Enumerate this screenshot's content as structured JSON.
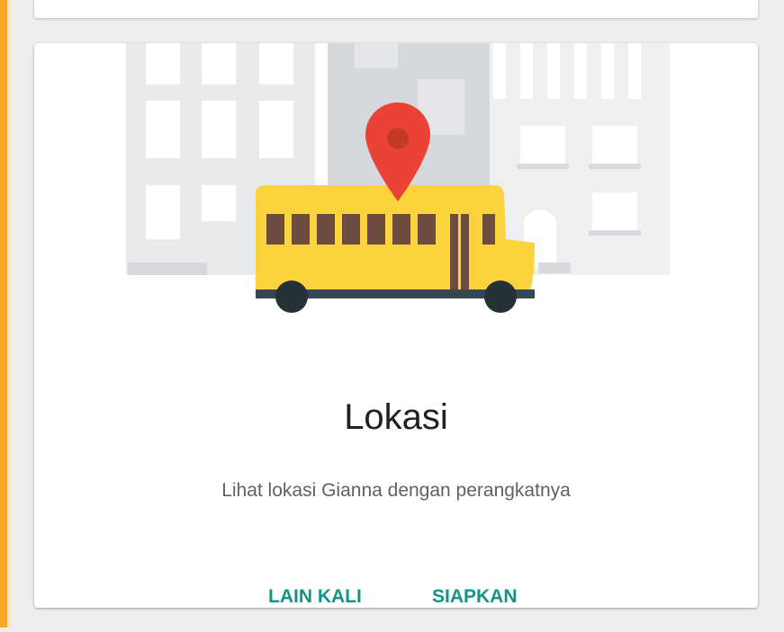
{
  "card": {
    "title": "Lokasi",
    "description": "Lihat lokasi Gianna dengan perangkatnya",
    "later_label": "LAIN KALI",
    "setup_label": "SIAPKAN"
  },
  "colors": {
    "accent": "#139486",
    "window_edge": "#f7a823",
    "bus_body": "#fbd33c",
    "bus_windows": "#6d4c41",
    "map_pin": "#ea4335",
    "wheels": "#263238",
    "buildings": "#e9eaec"
  },
  "icons": {
    "illustration": "school-bus-location-illustration",
    "pin": "map-pin-icon"
  }
}
